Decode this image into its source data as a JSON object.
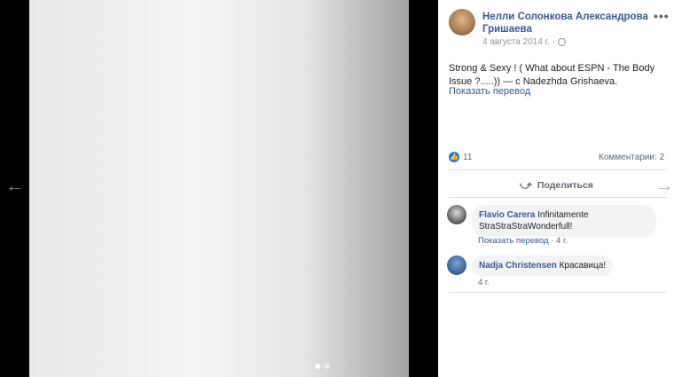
{
  "viewer": {
    "prev_arrow": "←",
    "next_arrow": "→",
    "photo_count": 2,
    "active_photo": 1
  },
  "post": {
    "author": "Нелли Солонкова Александрова Гришаева",
    "date": "4 августа 2014 г.",
    "date_suffix": "·",
    "privacy_icon": "globe-icon",
    "more": "•••",
    "text": "Strong & Sexy ! ( What about ESPN - The Body Issue ?.....)) — с Nadezhda Grishaeva.",
    "translate": "Показать перевод",
    "likes_count": "11",
    "comments_label": "Комментарии: 2",
    "share_label": "Поделиться"
  },
  "comments": [
    {
      "author": "Flavio Carera",
      "text": "Infinitamente StraStraStraWonderfull!",
      "translate": "Показать перевод",
      "time": "4 г."
    },
    {
      "author": "Nadja Christensen",
      "text": "Красавица!",
      "time": "4 г."
    }
  ],
  "colors": {
    "link": "#385898",
    "like": "#1877f2",
    "muted": "#606770"
  }
}
